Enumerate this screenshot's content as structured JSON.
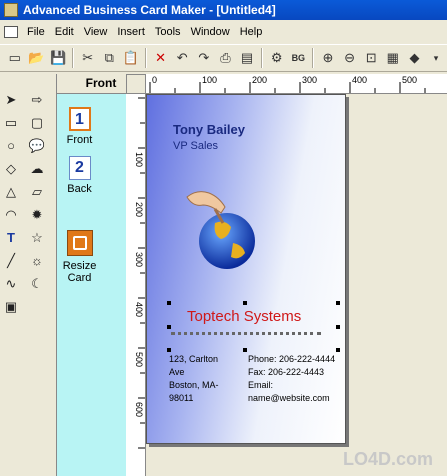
{
  "window": {
    "title": "Advanced Business Card Maker - [Untitled4]"
  },
  "menu": [
    "File",
    "Edit",
    "View",
    "Insert",
    "Tools",
    "Window",
    "Help"
  ],
  "toolbar": [
    "new-icon",
    "open-icon",
    "save-icon",
    "cut-icon",
    "copy-icon",
    "paste-icon",
    "delete-icon",
    "undo-icon",
    "redo-icon",
    "print-icon",
    "print-preview-icon",
    "properties-icon",
    "background-icon",
    "zoom-in-icon",
    "zoom-out-icon",
    "zoom-fit-icon",
    "grid-icon",
    "eraser-icon"
  ],
  "tools_left": [
    "select-arrow-icon",
    "rectangle-icon",
    "ellipse-icon",
    "diamond-icon",
    "triangle-icon",
    "arc-icon",
    "text-icon",
    "line-icon",
    "curve-icon",
    "image-icon"
  ],
  "tools_right": [
    "arrow-shape-icon",
    "rounded-rect-icon",
    "callout-icon",
    "cloud-callout-icon",
    "parallelogram-icon",
    "burst-icon",
    "star-icon",
    "sun-icon",
    "moon-icon"
  ],
  "pages_panel": {
    "header": "Front",
    "items": [
      {
        "num": "1",
        "label": "Front"
      },
      {
        "num": "2",
        "label": "Back"
      }
    ],
    "resize_label": "Resize Card"
  },
  "ruler": {
    "h_ticks": [
      "0",
      "100",
      "200",
      "300",
      "400",
      "500"
    ],
    "v_ticks": [
      "100",
      "200",
      "300",
      "400",
      "500",
      "600"
    ]
  },
  "card": {
    "name": "Tony Bailey",
    "job_title": "VP Sales",
    "company": "Toptech Systems",
    "address": [
      "123, Carlton",
      "Ave",
      "Boston, MA-",
      "98011"
    ],
    "contact": [
      "Phone: 206-222-4444",
      "Fax: 206-222-4443",
      "Email:",
      "name@website.com"
    ]
  },
  "watermark": "LO4D.com",
  "colors": {
    "titlebar": "#0a5ad8",
    "company": "#d01818",
    "name": "#1a2a80",
    "pages_bg": "#b8f4f4"
  }
}
